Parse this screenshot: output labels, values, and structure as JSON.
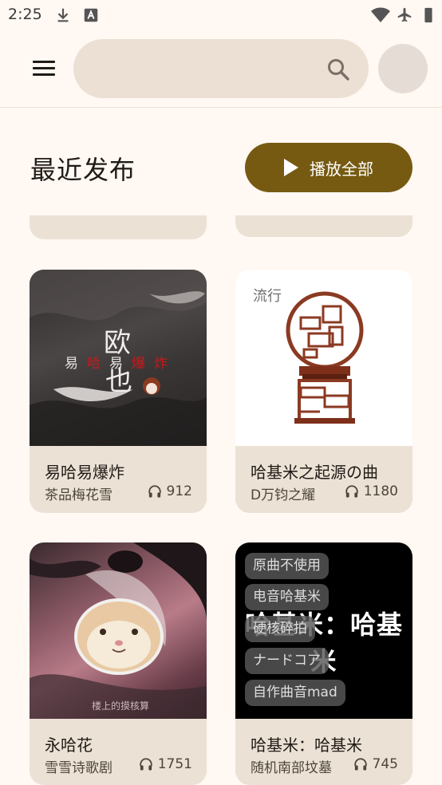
{
  "status_bar": {
    "time": "2:25",
    "icons": [
      "download-icon",
      "text-notification-icon",
      "wifi-icon",
      "airplane-mode-icon"
    ]
  },
  "search": {
    "value": "",
    "placeholder": ""
  },
  "section": {
    "title": "最近发布",
    "play_all_label": "播放全部"
  },
  "songs": [
    {
      "title": "易哈易爆炸",
      "artist": "茶品梅花雪",
      "plays": "912",
      "cover_text": [
        "欧",
        "也",
        "易",
        "哈",
        "易",
        "爆",
        "炸"
      ]
    },
    {
      "title": "哈基米之起源の曲",
      "artist": "D万钧之耀",
      "plays": "1180",
      "genre": "流行"
    },
    {
      "title": "永哈花",
      "artist": "雪雪诗歌剧",
      "plays": "1751",
      "cover_watermark": "楼上的摸核算"
    },
    {
      "title": "哈基米：哈基米",
      "artist": "随机南部坟墓",
      "plays": "745",
      "cover_text": "哈基米：哈基米",
      "tags": [
        "原曲不使用",
        "电音哈基米",
        "硬核碎拍",
        "ナードコア",
        "自作曲音mad"
      ]
    }
  ],
  "colors": {
    "background": "#fff8f3",
    "card": "#ebe1d5",
    "accent": "#765a12",
    "search_bg": "#ebe0d3"
  }
}
